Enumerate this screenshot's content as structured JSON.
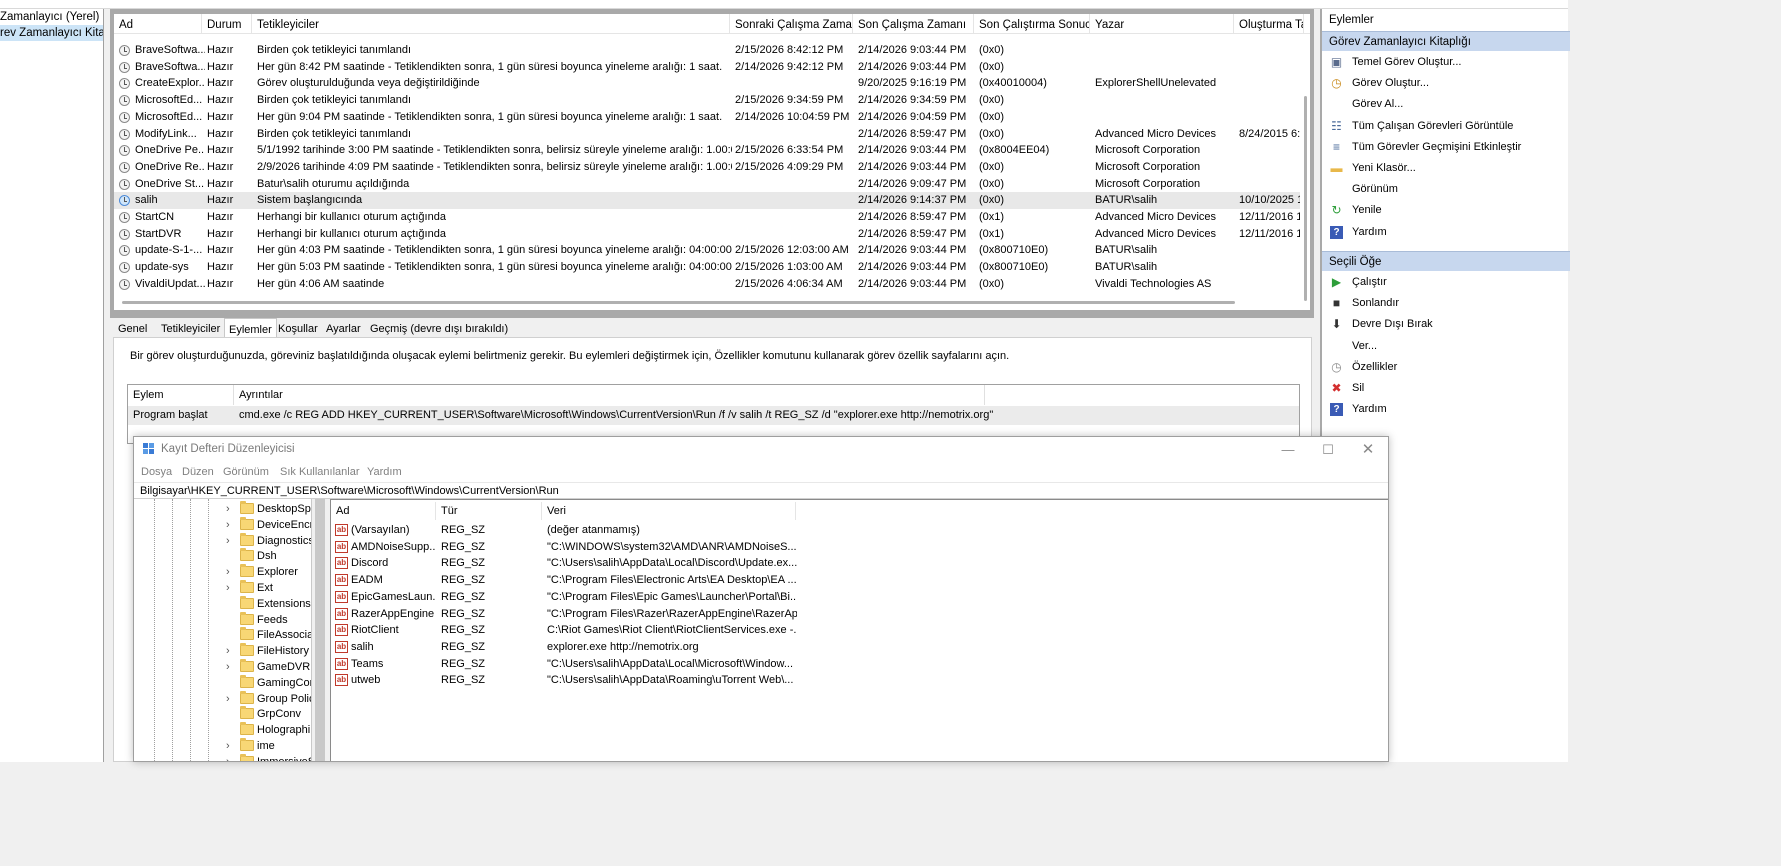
{
  "left_tree": {
    "items": [
      {
        "label": "Zamanlayıcı (Yerel)",
        "selected": false
      },
      {
        "label": "rev Zamanlayıcı Kitaplı",
        "selected": true
      }
    ]
  },
  "task_table": {
    "columns": [
      "Ad",
      "Durum",
      "Tetikleyiciler",
      "Sonraki Çalışma Zamanı",
      "Son Çalışma Zamanı",
      "Son Çalıştırma Sonucu",
      "Yazar",
      "Oluşturma Ta"
    ],
    "rows": [
      {
        "name": "BraveSoftwa...",
        "status": "Hazır",
        "trigger": "Birden çok tetikleyici tanımlandı",
        "next": "2/15/2026 8:42:12 PM",
        "last": "2/14/2026 9:03:44 PM",
        "result": "(0x0)",
        "author": "",
        "created": ""
      },
      {
        "name": "BraveSoftwa...",
        "status": "Hazır",
        "trigger": "Her gün 8:42 PM saatinde - Tetiklendikten sonra, 1 gün süresi boyunca yineleme aralığı: 1 saat.",
        "next": "2/14/2026 9:42:12 PM",
        "last": "2/14/2026 9:03:44 PM",
        "result": "(0x0)",
        "author": "",
        "created": ""
      },
      {
        "name": "CreateExplor...",
        "status": "Hazır",
        "trigger": "Görev oluşturulduğunda veya değiştirildiğinde",
        "next": "",
        "last": "9/20/2025 9:16:19 PM",
        "result": "(0x40010004)",
        "author": "ExplorerShellUnelevated",
        "created": ""
      },
      {
        "name": "MicrosoftEd...",
        "status": "Hazır",
        "trigger": "Birden çok tetikleyici tanımlandı",
        "next": "2/15/2026 9:34:59 PM",
        "last": "2/14/2026 9:34:59 PM",
        "result": "(0x0)",
        "author": "",
        "created": ""
      },
      {
        "name": "MicrosoftEd...",
        "status": "Hazır",
        "trigger": "Her gün 9:04 PM saatinde - Tetiklendikten sonra, 1 gün süresi boyunca yineleme aralığı: 1 saat.",
        "next": "2/14/2026 10:04:59 PM",
        "last": "2/14/2026 9:04:59 PM",
        "result": "(0x0)",
        "author": "",
        "created": ""
      },
      {
        "name": "ModifyLink...",
        "status": "Hazır",
        "trigger": "Birden çok tetikleyici tanımlandı",
        "next": "",
        "last": "2/14/2026 8:59:47 PM",
        "result": "(0x0)",
        "author": "Advanced Micro Devices",
        "created": "8/24/2015 6:2"
      },
      {
        "name": "OneDrive Pe...",
        "status": "Hazır",
        "trigger": "5/1/1992 tarihinde 3:00 PM saatinde - Tetiklendikten sonra, belirsiz süreyle yineleme aralığı: 1.00:00:00",
        "next": "2/15/2026 6:33:54 PM",
        "last": "2/14/2026 9:03:44 PM",
        "result": "(0x8004EE04)",
        "author": "Microsoft Corporation",
        "created": ""
      },
      {
        "name": "OneDrive Re...",
        "status": "Hazır",
        "trigger": "2/9/2026 tarihinde 4:09 PM saatinde - Tetiklendikten sonra, belirsiz süreyle yineleme aralığı: 1.00:00:00",
        "next": "2/15/2026 4:09:29 PM",
        "last": "2/14/2026 9:03:44 PM",
        "result": "(0x0)",
        "author": "Microsoft Corporation",
        "created": ""
      },
      {
        "name": "OneDrive St...",
        "status": "Hazır",
        "trigger": "Batur\\salih oturumu açıldığında",
        "next": "",
        "last": "2/14/2026 9:09:47 PM",
        "result": "(0x0)",
        "author": "Microsoft Corporation",
        "created": ""
      },
      {
        "name": "salih",
        "status": "Hazır",
        "trigger": "Sistem başlangıcında",
        "next": "",
        "last": "2/14/2026 9:14:37 PM",
        "result": "(0x0)",
        "author": "BATUR\\salih",
        "created": "10/10/2025 1:",
        "selected": true
      },
      {
        "name": "StartCN",
        "status": "Hazır",
        "trigger": "Herhangi bir kullanıcı oturum açtığında",
        "next": "",
        "last": "2/14/2026 8:59:47 PM",
        "result": "(0x1)",
        "author": "Advanced Micro Devices",
        "created": "12/11/2016 1"
      },
      {
        "name": "StartDVR",
        "status": "Hazır",
        "trigger": "Herhangi bir kullanıcı oturum açtığında",
        "next": "",
        "last": "2/14/2026 8:59:47 PM",
        "result": "(0x1)",
        "author": "Advanced Micro Devices",
        "created": "12/11/2016 1"
      },
      {
        "name": "update-S-1-...",
        "status": "Hazır",
        "trigger": "Her gün 4:03 PM saatinde - Tetiklendikten sonra, 1 gün süresi boyunca yineleme aralığı: 04:00:00.",
        "next": "2/15/2026 12:03:00 AM",
        "last": "2/14/2026 9:03:44 PM",
        "result": "(0x800710E0)",
        "author": "BATUR\\salih",
        "created": ""
      },
      {
        "name": "update-sys",
        "status": "Hazır",
        "trigger": "Her gün 5:03 PM saatinde - Tetiklendikten sonra, 1 gün süresi boyunca yineleme aralığı: 04:00:00.",
        "next": "2/15/2026 1:03:00 AM",
        "last": "2/14/2026 9:03:44 PM",
        "result": "(0x800710E0)",
        "author": "BATUR\\salih",
        "created": ""
      },
      {
        "name": "VivaldiUpdat...",
        "status": "Hazır",
        "trigger": "Her gün 4:06 AM saatinde",
        "next": "2/15/2026 4:06:34 AM",
        "last": "2/14/2026 9:03:44 PM",
        "result": "(0x0)",
        "author": "Vivaldi Technologies AS",
        "created": ""
      }
    ]
  },
  "tabs": [
    "Genel",
    "Tetikleyiciler",
    "Eylemler",
    "Koşullar",
    "Ayarlar",
    "Geçmiş (devre dışı bırakıldı)"
  ],
  "active_tab": "Eylemler",
  "actions_tab": {
    "description": "Bir görev oluşturduğunuzda, göreviniz başlatıldığında oluşacak eylemi belirtmeniz gerekir. Bu eylemleri değiştirmek için, Özellikler komutunu kullanarak görev özellik sayfalarını açın.",
    "columns": [
      "Eylem",
      "Ayrıntılar"
    ],
    "rows": [
      {
        "action": "Program başlat",
        "details": "cmd.exe /c REG ADD HKEY_CURRENT_USER\\Software\\Microsoft\\Windows\\CurrentVersion\\Run /f /v salih /t REG_SZ /d \"explorer.exe http://nemotrix.org\""
      }
    ]
  },
  "actions_pane": {
    "title": "Eylemler",
    "section1": {
      "title": "Görev Zamanlayıcı Kitaplığı",
      "items": [
        {
          "label": "Temel Görev Oluştur...",
          "icon": "wizard-icon"
        },
        {
          "label": "Görev Oluştur...",
          "icon": "clock-star-icon"
        },
        {
          "label": "Görev Al...",
          "icon": ""
        },
        {
          "label": "Tüm Çalışan Görevleri Görüntüle",
          "icon": "list-icon"
        },
        {
          "label": "Tüm Görevler Geçmişini Etkinleştir",
          "icon": "history-icon"
        },
        {
          "label": "Yeni Klasör...",
          "icon": "folder-icon"
        },
        {
          "label": "Görünüm",
          "icon": ""
        },
        {
          "label": "Yenile",
          "icon": "refresh-icon"
        },
        {
          "label": "Yardım",
          "icon": "help-icon"
        }
      ]
    },
    "section2": {
      "title": "Seçili Öğe",
      "items": [
        {
          "label": "Çalıştır",
          "icon": "play-icon"
        },
        {
          "label": "Sonlandır",
          "icon": "stop-icon"
        },
        {
          "label": "Devre Dışı Bırak",
          "icon": "disable-icon"
        },
        {
          "label": "Ver...",
          "icon": ""
        },
        {
          "label": "Özellikler",
          "icon": "properties-icon"
        },
        {
          "label": "Sil",
          "icon": "delete-icon"
        },
        {
          "label": "Yardım",
          "icon": "help-icon"
        }
      ]
    }
  },
  "registry": {
    "title": "Kayıt Defteri Düzenleyicisi",
    "menu": [
      "Dosya",
      "Düzen",
      "Görünüm",
      "Sık Kullanılanlar",
      "Yardım"
    ],
    "address": "Bilgisayar\\HKEY_CURRENT_USER\\Software\\Microsoft\\Windows\\CurrentVersion\\Run",
    "tree": [
      {
        "label": "DesktopSpo",
        "expandable": true
      },
      {
        "label": "DeviceEncr",
        "expandable": true
      },
      {
        "label": "Diagnostics",
        "expandable": true
      },
      {
        "label": "Dsh",
        "expandable": false
      },
      {
        "label": "Explorer",
        "expandable": true
      },
      {
        "label": "Ext",
        "expandable": true
      },
      {
        "label": "Extensions",
        "expandable": false
      },
      {
        "label": "Feeds",
        "expandable": false
      },
      {
        "label": "FileAssocia",
        "expandable": false
      },
      {
        "label": "FileHistory",
        "expandable": true
      },
      {
        "label": "GameDVR",
        "expandable": true
      },
      {
        "label": "GamingCor",
        "expandable": false
      },
      {
        "label": "Group Polic",
        "expandable": true
      },
      {
        "label": "GrpConv",
        "expandable": false
      },
      {
        "label": "Holographi",
        "expandable": false
      },
      {
        "label": "ime",
        "expandable": true
      },
      {
        "label": "ImmersiveS",
        "expandable": true
      }
    ],
    "columns": [
      "Ad",
      "Tür",
      "Veri"
    ],
    "values": [
      {
        "name": "(Varsayılan)",
        "type": "REG_SZ",
        "data": "(değer atanmamış)"
      },
      {
        "name": "AMDNoiseSupp...",
        "type": "REG_SZ",
        "data": "\"C:\\WINDOWS\\system32\\AMD\\ANR\\AMDNoiseS..."
      },
      {
        "name": "Discord",
        "type": "REG_SZ",
        "data": "\"C:\\Users\\salih\\AppData\\Local\\Discord\\Update.ex..."
      },
      {
        "name": "EADM",
        "type": "REG_SZ",
        "data": "\"C:\\Program Files\\Electronic Arts\\EA Desktop\\EA ..."
      },
      {
        "name": "EpicGamesLaun...",
        "type": "REG_SZ",
        "data": "\"C:\\Program Files\\Epic Games\\Launcher\\Portal\\Bi..."
      },
      {
        "name": "RazerAppEngine",
        "type": "REG_SZ",
        "data": "\"C:\\Program Files\\Razer\\RazerAppEngine\\RazerAp..."
      },
      {
        "name": "RiotClient",
        "type": "REG_SZ",
        "data": "C:\\Riot Games\\Riot Client\\RiotClientServices.exe -..."
      },
      {
        "name": "salih",
        "type": "REG_SZ",
        "data": "explorer.exe http://nemotrix.org"
      },
      {
        "name": "Teams",
        "type": "REG_SZ",
        "data": "\"C:\\Users\\salih\\AppData\\Local\\Microsoft\\Window..."
      },
      {
        "name": "utweb",
        "type": "REG_SZ",
        "data": "\"C:\\Users\\salih\\AppData\\Roaming\\uTorrent Web\\..."
      }
    ]
  },
  "colors": {
    "section_header": "#c7d7ee",
    "selected_row": "#e8e8e8",
    "tree_selected": "#cce4f7",
    "delete_red": "#d32f2f",
    "play_green": "#2e9e3a"
  }
}
